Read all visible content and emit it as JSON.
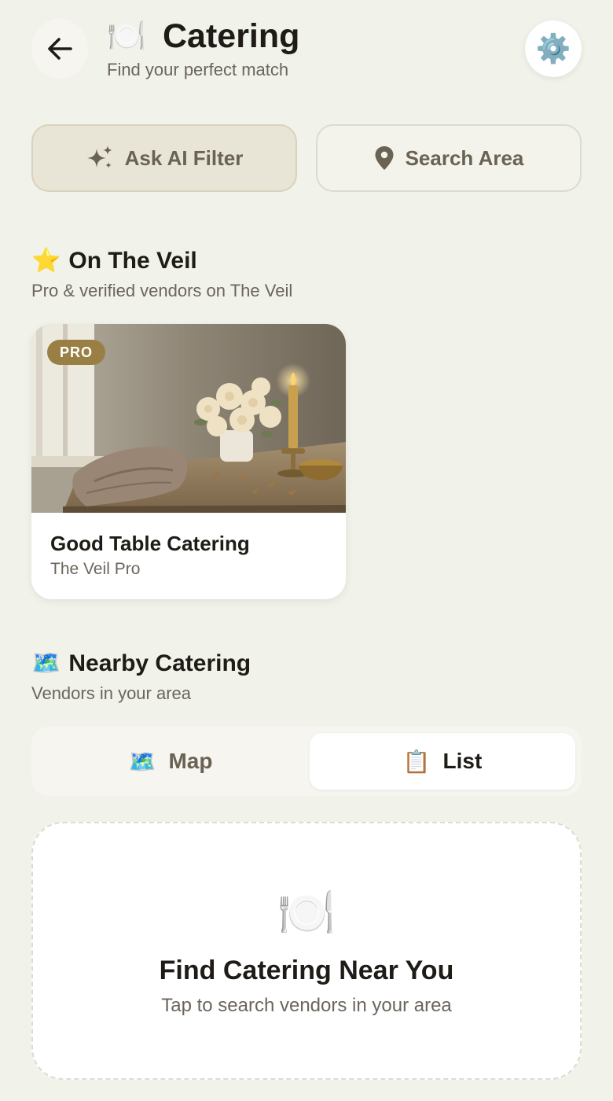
{
  "header": {
    "title_icon": "🍽️",
    "title": "Catering",
    "subtitle": "Find your perfect match",
    "settings_icon": "⚙️"
  },
  "actions": {
    "ai_filter_label": "Ask AI Filter",
    "search_area_label": "Search Area"
  },
  "featured": {
    "icon": "⭐",
    "title": "On The Veil",
    "subtitle": "Pro & verified vendors on The Veil",
    "vendors": [
      {
        "badge": "PRO",
        "name": "Good Table Catering",
        "tier": "The Veil Pro"
      }
    ]
  },
  "nearby": {
    "icon": "🗺️",
    "title": "Nearby Catering",
    "subtitle": "Vendors in your area",
    "toggle": {
      "map_icon": "🗺️",
      "map_label": "Map",
      "list_icon": "📋",
      "list_label": "List",
      "selected": "List"
    },
    "empty": {
      "icon": "🍽️",
      "title": "Find Catering Near You",
      "subtitle": "Tap to search vendors in your area"
    }
  },
  "colors": {
    "background": "#f1f2ea",
    "accent": "#9a7f45",
    "text_primary": "#1f1c17",
    "text_secondary": "#6b655c"
  }
}
